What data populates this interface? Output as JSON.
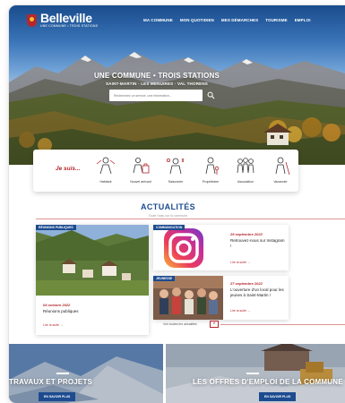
{
  "brand": {
    "name": "Belleville",
    "tagline": "UNE COMMUNE • TROIS STATIONS"
  },
  "nav": [
    "MA COMMUNE",
    "MON QUOTIDIEN",
    "MES DÉMARCHES",
    "TOURISME",
    "EMPLOI"
  ],
  "hero": {
    "title": "UNE COMMUNE • TROIS STATIONS",
    "subtitle": "SAINT-MARTIN · LES MENUIRES · VAL THORENS",
    "search_placeholder": "Recherchez un service, une information..."
  },
  "jesuis": {
    "label": "Je suis...",
    "personas": [
      "Habitant",
      "Nouvel arrivant",
      "Saisonnier",
      "Propriétaire",
      "Association",
      "Vacancier"
    ]
  },
  "news": {
    "title": "ACTUALITÉS",
    "subtitle": "Toute l'actu sur la commune",
    "cards": [
      {
        "tag": "RÉUNIONS PUBLIQUES",
        "date": "04 octobre 2022",
        "text": "Réunions publiques",
        "link": "Lire la suite →"
      },
      {
        "tag": "COMMUNICATION",
        "date": "29 septembre 2022",
        "text": "Retrouvez-nous sur Instagram !",
        "link": "Lire la suite →"
      },
      {
        "tag": "JEUNESSE",
        "date": "27 septembre 2022",
        "text": "L'ouverture d'un local pour les jeunes à Saint-Martin !",
        "link": "Lire la suite →"
      }
    ],
    "all_label": "Voir toutes les actualités",
    "plus": "+"
  },
  "banners": [
    {
      "title": "TRAVAUX ET PROJETS",
      "button": "EN SAVOIR PLUS"
    },
    {
      "title": "LES OFFRES D'EMPLOI DE LA COMMUNE",
      "button": "EN SAVOIR PLUS"
    }
  ],
  "colors": {
    "brand_red": "#b5272d",
    "brand_blue": "#1d4b8f"
  }
}
